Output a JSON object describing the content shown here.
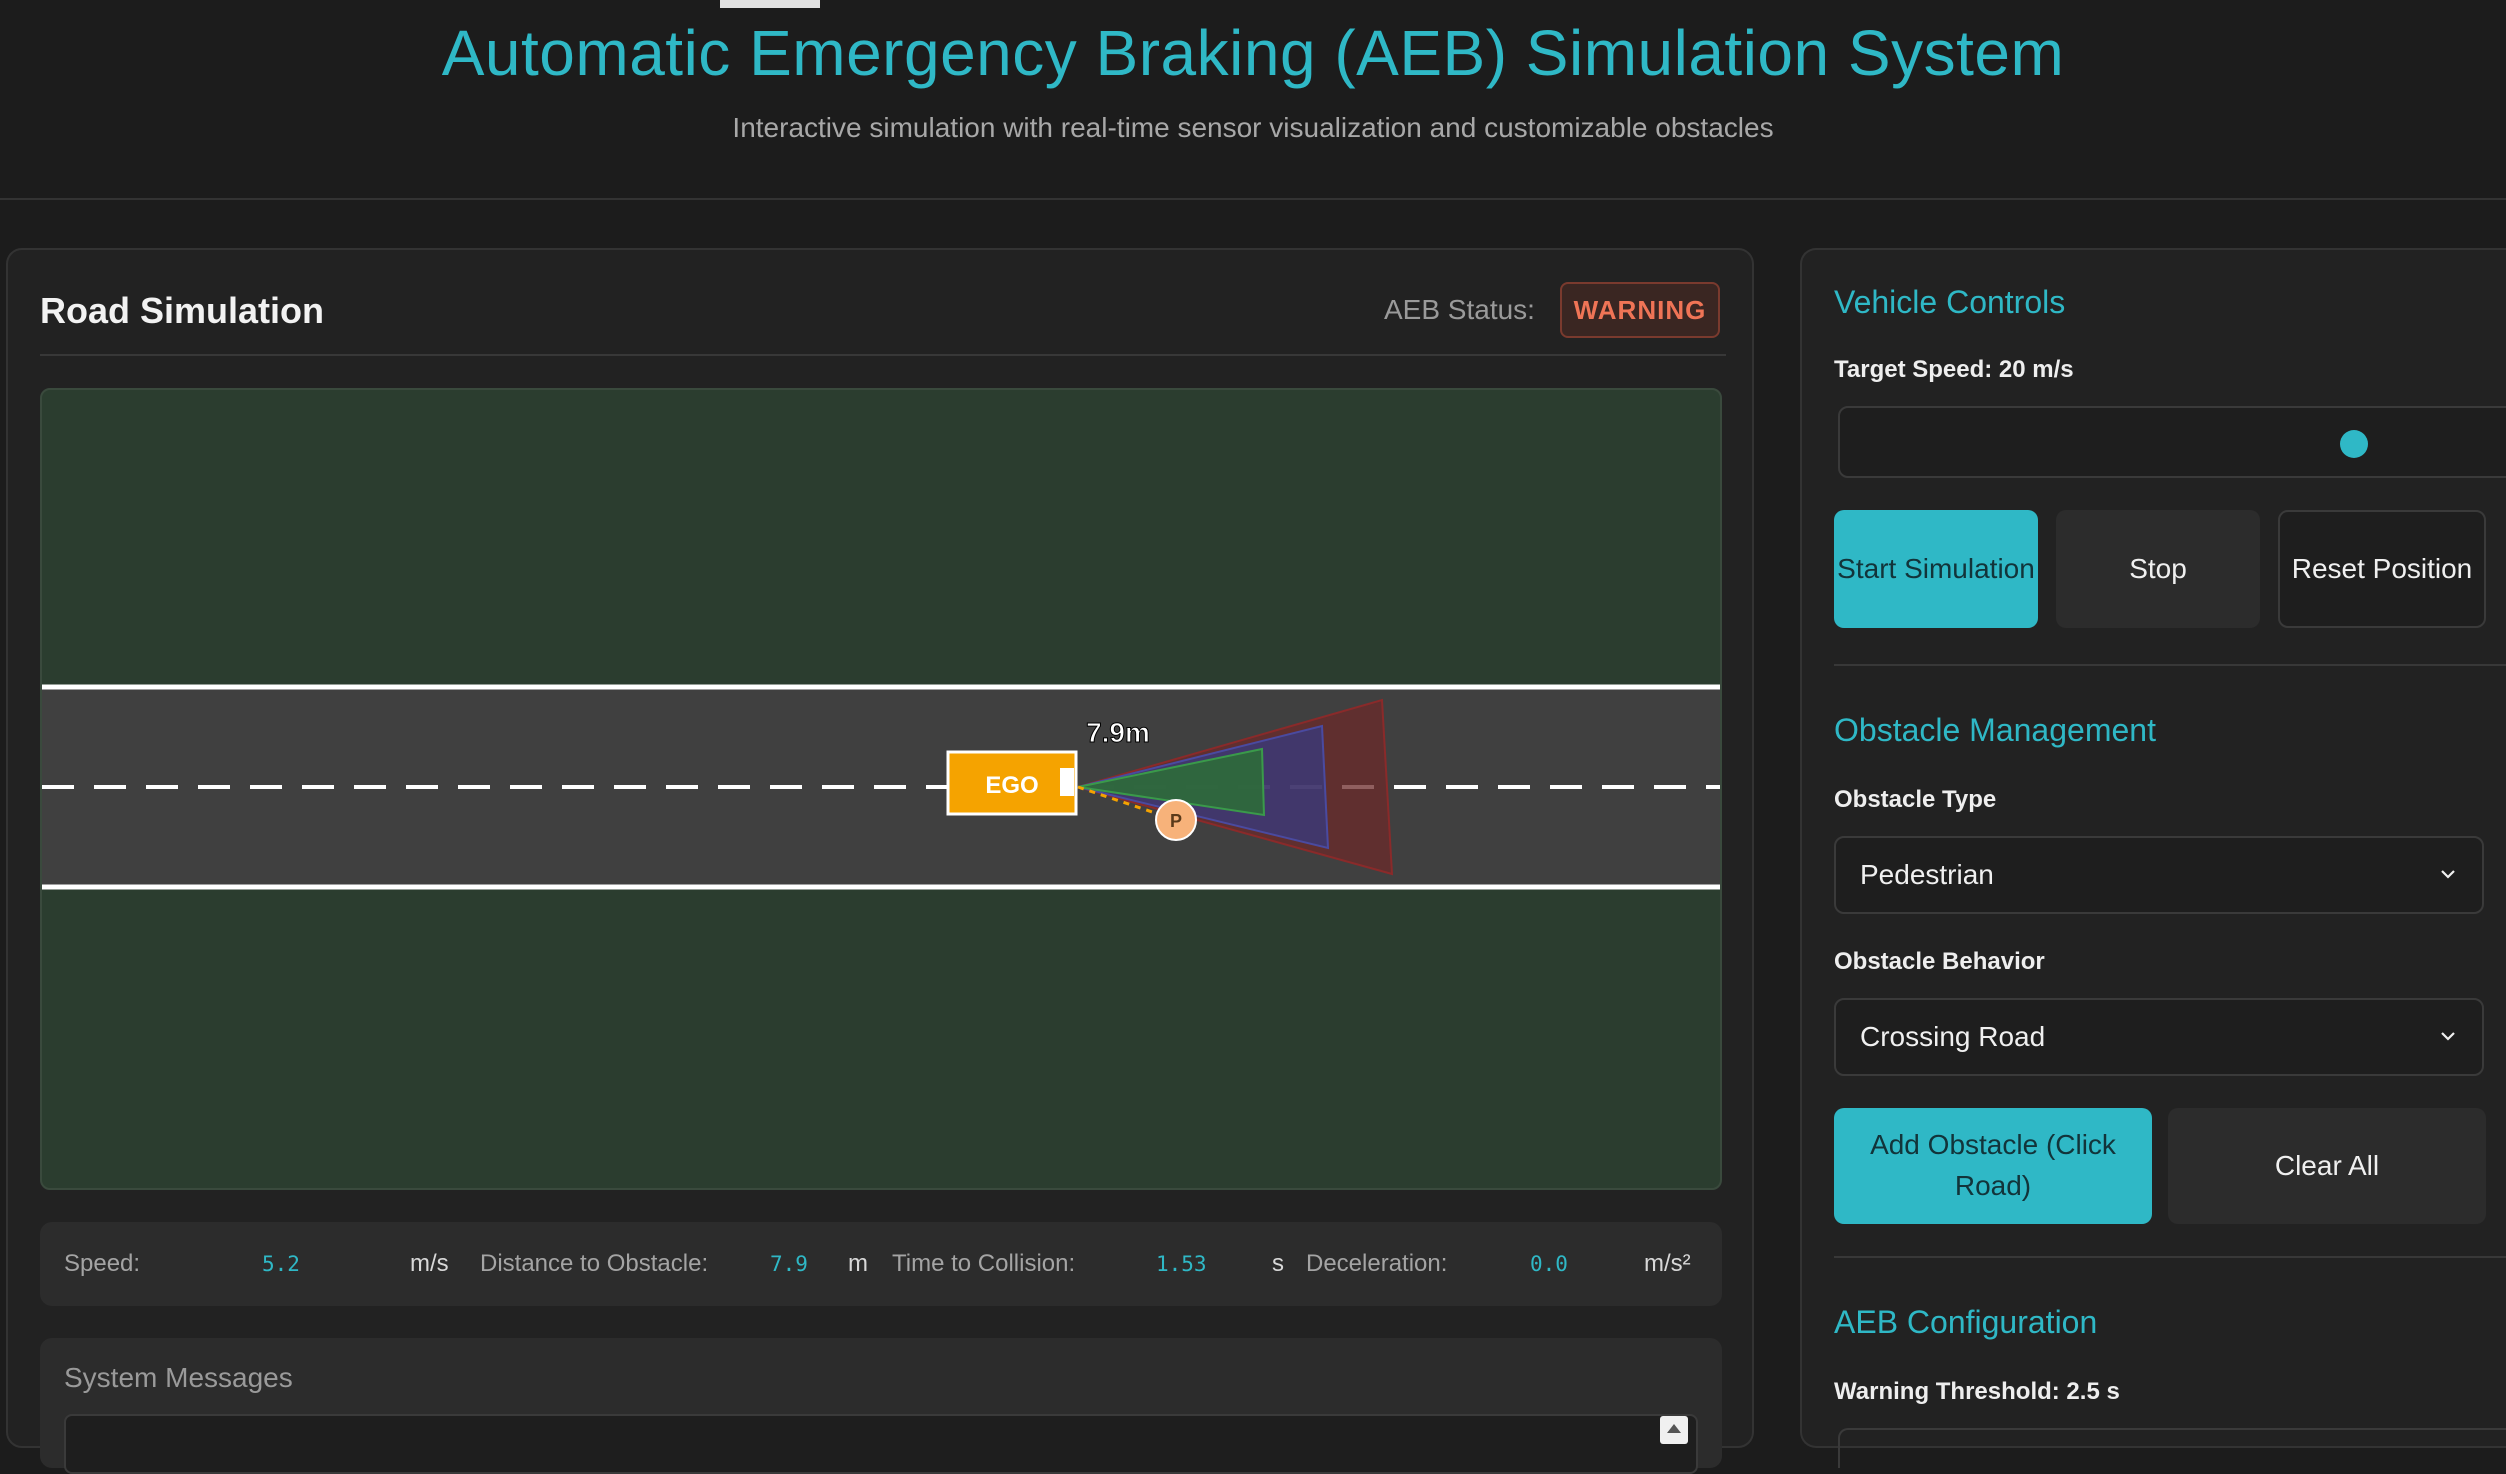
{
  "header": {
    "title": "Automatic Emergency Braking (AEB) Simulation System",
    "subtitle": "Interactive simulation with real-time sensor visualization and customizable obstacles"
  },
  "road": {
    "title": "Road Simulation",
    "aeb_status_label": "AEB Status:",
    "aeb_status": "WARNING",
    "ego_label": "EGO",
    "distance_label": "7.9m",
    "obstacle_marker": "P"
  },
  "stats": {
    "speed_label": "Speed:",
    "speed_value": "5.2",
    "speed_unit": "m/s",
    "distance_label": "Distance to Obstacle:",
    "distance_value": "7.9",
    "distance_unit": "m",
    "ttc_label": "Time to Collision:",
    "ttc_value": "1.53",
    "ttc_unit": "s",
    "decel_label": "Deceleration:",
    "decel_value": "0.0",
    "decel_unit": "m/s²"
  },
  "messages": {
    "title": "System Messages"
  },
  "controls": {
    "vehicle_title": "Vehicle Controls",
    "target_speed_label": "Target Speed: 20 m/s",
    "target_speed_fraction": 0.76,
    "start_button": "Start Simulation",
    "stop_button": "Stop",
    "reset_button": "Reset Position",
    "obstacle_title": "Obstacle Management",
    "obstacle_type_label": "Obstacle Type",
    "obstacle_type_value": "Pedestrian",
    "obstacle_behavior_label": "Obstacle Behavior",
    "obstacle_behavior_value": "Crossing Road",
    "add_obstacle_button": "Add Obstacle (Click Road)",
    "clear_all_button": "Clear All",
    "aeb_config_title": "AEB Configuration",
    "warning_threshold_label": "Warning Threshold: 2.5 s"
  },
  "colors": {
    "accent": "#2fb8c6",
    "warning": "#ef7456",
    "ego": "#f5a300",
    "grass": "#2b3d2f",
    "road": "#404040"
  }
}
